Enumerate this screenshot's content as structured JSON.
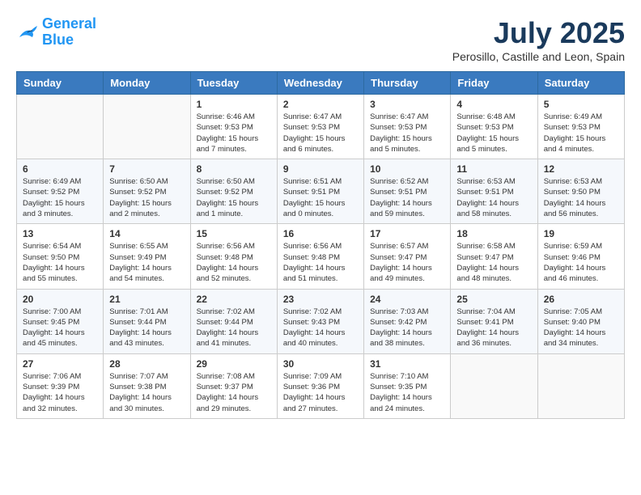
{
  "logo": {
    "line1": "General",
    "line2": "Blue"
  },
  "title": "July 2025",
  "subtitle": "Perosillo, Castille and Leon, Spain",
  "weekdays": [
    "Sunday",
    "Monday",
    "Tuesday",
    "Wednesday",
    "Thursday",
    "Friday",
    "Saturday"
  ],
  "weeks": [
    [
      {
        "day": "",
        "info": ""
      },
      {
        "day": "",
        "info": ""
      },
      {
        "day": "1",
        "info": "Sunrise: 6:46 AM\nSunset: 9:53 PM\nDaylight: 15 hours and 7 minutes."
      },
      {
        "day": "2",
        "info": "Sunrise: 6:47 AM\nSunset: 9:53 PM\nDaylight: 15 hours and 6 minutes."
      },
      {
        "day": "3",
        "info": "Sunrise: 6:47 AM\nSunset: 9:53 PM\nDaylight: 15 hours and 5 minutes."
      },
      {
        "day": "4",
        "info": "Sunrise: 6:48 AM\nSunset: 9:53 PM\nDaylight: 15 hours and 5 minutes."
      },
      {
        "day": "5",
        "info": "Sunrise: 6:49 AM\nSunset: 9:53 PM\nDaylight: 15 hours and 4 minutes."
      }
    ],
    [
      {
        "day": "6",
        "info": "Sunrise: 6:49 AM\nSunset: 9:52 PM\nDaylight: 15 hours and 3 minutes."
      },
      {
        "day": "7",
        "info": "Sunrise: 6:50 AM\nSunset: 9:52 PM\nDaylight: 15 hours and 2 minutes."
      },
      {
        "day": "8",
        "info": "Sunrise: 6:50 AM\nSunset: 9:52 PM\nDaylight: 15 hours and 1 minute."
      },
      {
        "day": "9",
        "info": "Sunrise: 6:51 AM\nSunset: 9:51 PM\nDaylight: 15 hours and 0 minutes."
      },
      {
        "day": "10",
        "info": "Sunrise: 6:52 AM\nSunset: 9:51 PM\nDaylight: 14 hours and 59 minutes."
      },
      {
        "day": "11",
        "info": "Sunrise: 6:53 AM\nSunset: 9:51 PM\nDaylight: 14 hours and 58 minutes."
      },
      {
        "day": "12",
        "info": "Sunrise: 6:53 AM\nSunset: 9:50 PM\nDaylight: 14 hours and 56 minutes."
      }
    ],
    [
      {
        "day": "13",
        "info": "Sunrise: 6:54 AM\nSunset: 9:50 PM\nDaylight: 14 hours and 55 minutes."
      },
      {
        "day": "14",
        "info": "Sunrise: 6:55 AM\nSunset: 9:49 PM\nDaylight: 14 hours and 54 minutes."
      },
      {
        "day": "15",
        "info": "Sunrise: 6:56 AM\nSunset: 9:48 PM\nDaylight: 14 hours and 52 minutes."
      },
      {
        "day": "16",
        "info": "Sunrise: 6:56 AM\nSunset: 9:48 PM\nDaylight: 14 hours and 51 minutes."
      },
      {
        "day": "17",
        "info": "Sunrise: 6:57 AM\nSunset: 9:47 PM\nDaylight: 14 hours and 49 minutes."
      },
      {
        "day": "18",
        "info": "Sunrise: 6:58 AM\nSunset: 9:47 PM\nDaylight: 14 hours and 48 minutes."
      },
      {
        "day": "19",
        "info": "Sunrise: 6:59 AM\nSunset: 9:46 PM\nDaylight: 14 hours and 46 minutes."
      }
    ],
    [
      {
        "day": "20",
        "info": "Sunrise: 7:00 AM\nSunset: 9:45 PM\nDaylight: 14 hours and 45 minutes."
      },
      {
        "day": "21",
        "info": "Sunrise: 7:01 AM\nSunset: 9:44 PM\nDaylight: 14 hours and 43 minutes."
      },
      {
        "day": "22",
        "info": "Sunrise: 7:02 AM\nSunset: 9:44 PM\nDaylight: 14 hours and 41 minutes."
      },
      {
        "day": "23",
        "info": "Sunrise: 7:02 AM\nSunset: 9:43 PM\nDaylight: 14 hours and 40 minutes."
      },
      {
        "day": "24",
        "info": "Sunrise: 7:03 AM\nSunset: 9:42 PM\nDaylight: 14 hours and 38 minutes."
      },
      {
        "day": "25",
        "info": "Sunrise: 7:04 AM\nSunset: 9:41 PM\nDaylight: 14 hours and 36 minutes."
      },
      {
        "day": "26",
        "info": "Sunrise: 7:05 AM\nSunset: 9:40 PM\nDaylight: 14 hours and 34 minutes."
      }
    ],
    [
      {
        "day": "27",
        "info": "Sunrise: 7:06 AM\nSunset: 9:39 PM\nDaylight: 14 hours and 32 minutes."
      },
      {
        "day": "28",
        "info": "Sunrise: 7:07 AM\nSunset: 9:38 PM\nDaylight: 14 hours and 30 minutes."
      },
      {
        "day": "29",
        "info": "Sunrise: 7:08 AM\nSunset: 9:37 PM\nDaylight: 14 hours and 29 minutes."
      },
      {
        "day": "30",
        "info": "Sunrise: 7:09 AM\nSunset: 9:36 PM\nDaylight: 14 hours and 27 minutes."
      },
      {
        "day": "31",
        "info": "Sunrise: 7:10 AM\nSunset: 9:35 PM\nDaylight: 14 hours and 24 minutes."
      },
      {
        "day": "",
        "info": ""
      },
      {
        "day": "",
        "info": ""
      }
    ]
  ]
}
